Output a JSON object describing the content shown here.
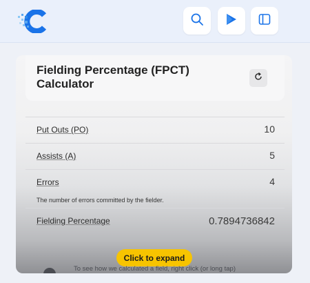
{
  "header": {
    "logo_icon": "calculator-logo-icon",
    "search_icon": "search-icon",
    "play_icon": "play-store-icon",
    "sidebar_icon": "sidebar-toggle-icon",
    "accent_color": "#1a73e8"
  },
  "calculator": {
    "title": "Fielding Percentage (FPCT) Calculator",
    "reload_icon": "reload-icon",
    "rows": [
      {
        "label": "Put Outs (PO)",
        "value": "10"
      },
      {
        "label": "Assists (A)",
        "value": "5"
      },
      {
        "label": "Errors",
        "value": "4",
        "note": "The number of errors committed by the fielder."
      },
      {
        "label": "Fielding Percentage",
        "value": "0.7894736842"
      }
    ],
    "expand_label": "Click to expand",
    "expand_color": "#f7c400",
    "hint": "To see how we calculated a field, right click (or long tap)",
    "info_icon": "info-icon"
  }
}
